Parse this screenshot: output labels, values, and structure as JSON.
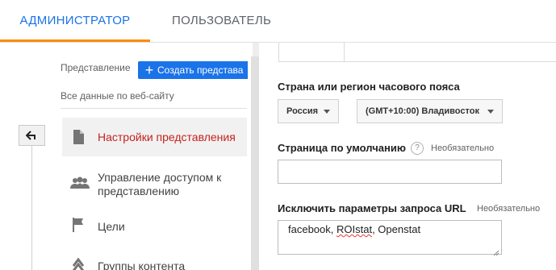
{
  "tabs": {
    "admin": "АДМИНИСТРАТОР",
    "user": "ПОЛЬЗОВАТЕЛЬ"
  },
  "left": {
    "view_label": "Представление",
    "create_view_button": "Создать представа",
    "view_name": "Все данные по веб-сайту",
    "nav": [
      {
        "label": "Настройки представления",
        "icon": "document-icon",
        "active": true
      },
      {
        "label_line1": "Управление доступом к",
        "label_line2": "представлению",
        "icon": "people-icon"
      },
      {
        "label": "Цели",
        "icon": "flag-icon"
      },
      {
        "label": "Группы контента",
        "icon": "content-groups-icon"
      }
    ]
  },
  "form": {
    "timezone_label": "Страна или регион часового пояса",
    "country_value": "Россия",
    "timezone_value": "(GMT+10:00) Владивосток",
    "default_page_label": "Страница по умолчанию",
    "default_page_optional": "Необязательно",
    "default_page_value": "",
    "exclude_params_label": "Исключить параметры запроса URL",
    "exclude_params_optional": "Необязательно",
    "exclude_params_value_part1": "facebook, ",
    "exclude_params_value_part2": "ROIstat",
    "exclude_params_value_part3": ", Openstat"
  },
  "colors": {
    "accent_blue": "#1a73e8",
    "tab_underline_orange": "#fb8c00",
    "active_red": "#c5221f"
  }
}
